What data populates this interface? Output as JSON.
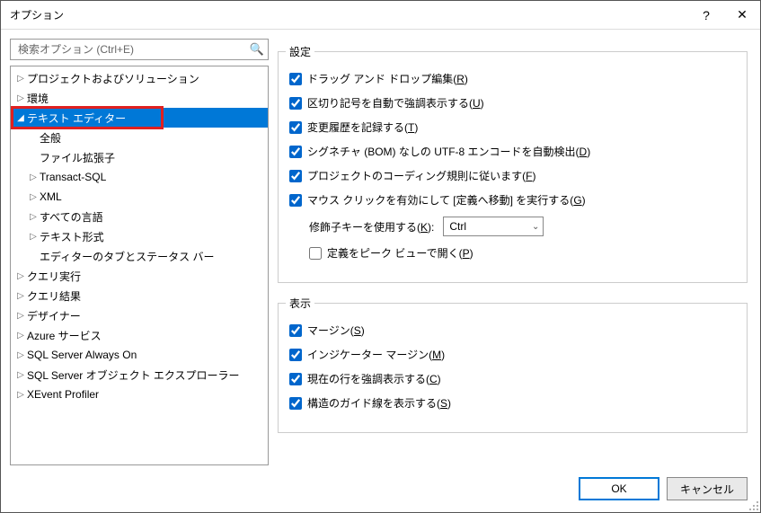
{
  "window": {
    "title": "オプション",
    "help_label": "?",
    "close_label": "✕"
  },
  "search": {
    "placeholder": "検索オプション (Ctrl+E)"
  },
  "tree": {
    "items": [
      {
        "label": "プロジェクトおよびソリューション",
        "depth": 1,
        "arrow": "▷"
      },
      {
        "label": "環境",
        "depth": 1,
        "arrow": "▷"
      },
      {
        "label": "テキスト エディター",
        "depth": 1,
        "arrow": "◢",
        "selected": true,
        "highlight": true
      },
      {
        "label": "全般",
        "depth": 2,
        "arrow": ""
      },
      {
        "label": "ファイル拡張子",
        "depth": 2,
        "arrow": ""
      },
      {
        "label": "Transact-SQL",
        "depth": 2,
        "arrow": "▷"
      },
      {
        "label": "XML",
        "depth": 2,
        "arrow": "▷"
      },
      {
        "label": "すべての言語",
        "depth": 2,
        "arrow": "▷"
      },
      {
        "label": "テキスト形式",
        "depth": 2,
        "arrow": "▷"
      },
      {
        "label": "エディターのタブとステータス バー",
        "depth": 2,
        "arrow": ""
      },
      {
        "label": "クエリ実行",
        "depth": 1,
        "arrow": "▷"
      },
      {
        "label": "クエリ結果",
        "depth": 1,
        "arrow": "▷"
      },
      {
        "label": "デザイナー",
        "depth": 1,
        "arrow": "▷"
      },
      {
        "label": "Azure サービス",
        "depth": 1,
        "arrow": "▷"
      },
      {
        "label": "SQL Server Always On",
        "depth": 1,
        "arrow": "▷"
      },
      {
        "label": "SQL Server オブジェクト エクスプローラー",
        "depth": 1,
        "arrow": "▷"
      },
      {
        "label": "XEvent Profiler",
        "depth": 1,
        "arrow": "▷"
      }
    ]
  },
  "settings_group": {
    "legend": "設定",
    "rows": [
      {
        "text": "ドラッグ アンド ドロップ編集",
        "key": "R",
        "checked": true
      },
      {
        "text": "区切り記号を自動で強調表示する",
        "key": "U",
        "checked": true
      },
      {
        "text": "変更履歴を記録する",
        "key": "T",
        "checked": true
      },
      {
        "text": "シグネチャ (BOM) なしの UTF-8 エンコードを自動検出",
        "key": "D",
        "checked": true
      },
      {
        "text": "プロジェクトのコーディング規則に従います",
        "key": "F",
        "checked": true
      },
      {
        "text": "マウス クリックを有効にして [定義へ移動] を実行する",
        "key": "G",
        "checked": true
      }
    ],
    "modifier_label": "修飾子キーを使用する",
    "modifier_key": "K",
    "modifier_value": "Ctrl",
    "peek_label": "定義をピーク ビューで開く",
    "peek_key": "P",
    "peek_checked": false
  },
  "display_group": {
    "legend": "表示",
    "rows": [
      {
        "text": "マージン",
        "key": "S",
        "checked": true
      },
      {
        "text": "インジケーター マージン",
        "key": "M",
        "checked": true
      },
      {
        "text": "現在の行を強調表示する",
        "key": "C",
        "checked": true
      },
      {
        "text": "構造のガイド線を表示する",
        "key": "S",
        "checked": true
      }
    ]
  },
  "buttons": {
    "ok": "OK",
    "cancel": "キャンセル"
  }
}
